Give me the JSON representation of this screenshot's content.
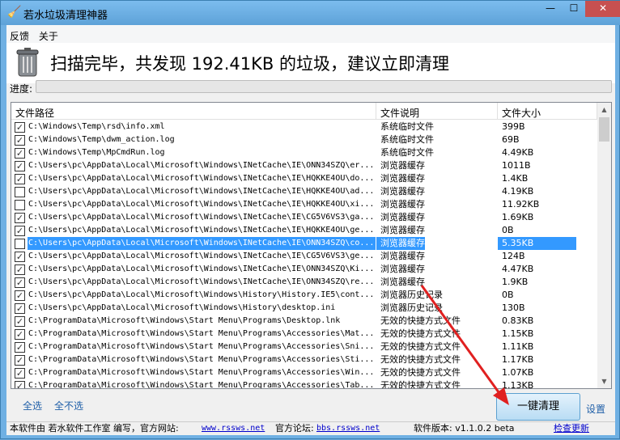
{
  "window": {
    "title": "若水垃圾清理神器",
    "minimize": "—",
    "maximize": "☐",
    "close": "✕"
  },
  "menu": [
    "反馈",
    "关于"
  ],
  "banner": {
    "headline": "扫描完毕，共发现 192.41KB 的垃圾，建议立即清理"
  },
  "progress": {
    "label": "进度:",
    "value": 0
  },
  "table": {
    "headers": [
      "文件路径",
      "文件说明",
      "文件大小"
    ],
    "rows": [
      {
        "checked": true,
        "path": "C:\\Windows\\Temp\\rsd\\info.xml",
        "desc": "系统临时文件",
        "size": "399B"
      },
      {
        "checked": true,
        "path": "C:\\Windows\\Temp\\dwm_action.log",
        "desc": "系统临时文件",
        "size": "69B"
      },
      {
        "checked": true,
        "path": "C:\\Windows\\Temp\\MpCmdRun.log",
        "desc": "系统临时文件",
        "size": "4.49KB"
      },
      {
        "checked": true,
        "path": "C:\\Users\\pc\\AppData\\Local\\Microsoft\\Windows\\INetCache\\IE\\ONN34SZQ\\er...",
        "desc": "浏览器缓存",
        "size": "1011B"
      },
      {
        "checked": true,
        "path": "C:\\Users\\pc\\AppData\\Local\\Microsoft\\Windows\\INetCache\\IE\\HQKKE4OU\\do...",
        "desc": "浏览器缓存",
        "size": "1.4KB"
      },
      {
        "checked": false,
        "path": "C:\\Users\\pc\\AppData\\Local\\Microsoft\\Windows\\INetCache\\IE\\HQKKE4OU\\ad...",
        "desc": "浏览器缓存",
        "size": "4.19KB"
      },
      {
        "checked": false,
        "path": "C:\\Users\\pc\\AppData\\Local\\Microsoft\\Windows\\INetCache\\IE\\HQKKE4OU\\xi...",
        "desc": "浏览器缓存",
        "size": "11.92KB"
      },
      {
        "checked": true,
        "path": "C:\\Users\\pc\\AppData\\Local\\Microsoft\\Windows\\INetCache\\IE\\CG5V6VS3\\ga...",
        "desc": "浏览器缓存",
        "size": "1.69KB"
      },
      {
        "checked": true,
        "path": "C:\\Users\\pc\\AppData\\Local\\Microsoft\\Windows\\INetCache\\IE\\HQKKE4OU\\ge...",
        "desc": "浏览器缓存",
        "size": "0B"
      },
      {
        "checked": false,
        "selected": true,
        "path": "C:\\Users\\pc\\AppData\\Local\\Microsoft\\Windows\\INetCache\\IE\\ONN34SZQ\\co...",
        "desc": "浏览器缓存",
        "size": "5.35KB"
      },
      {
        "checked": true,
        "path": "C:\\Users\\pc\\AppData\\Local\\Microsoft\\Windows\\INetCache\\IE\\CG5V6VS3\\ge...",
        "desc": "浏览器缓存",
        "size": "124B"
      },
      {
        "checked": true,
        "path": "C:\\Users\\pc\\AppData\\Local\\Microsoft\\Windows\\INetCache\\IE\\ONN34SZQ\\Ki...",
        "desc": "浏览器缓存",
        "size": "4.47KB"
      },
      {
        "checked": true,
        "path": "C:\\Users\\pc\\AppData\\Local\\Microsoft\\Windows\\INetCache\\IE\\ONN34SZQ\\re...",
        "desc": "浏览器缓存",
        "size": "1.9KB"
      },
      {
        "checked": true,
        "path": "C:\\Users\\pc\\AppData\\Local\\Microsoft\\Windows\\History\\History.IE5\\cont...",
        "desc": "浏览器历史记录",
        "size": "0B"
      },
      {
        "checked": true,
        "path": "C:\\Users\\pc\\AppData\\Local\\Microsoft\\Windows\\History\\desktop.ini",
        "desc": "浏览器历史记录",
        "size": "130B"
      },
      {
        "checked": true,
        "path": "C:\\ProgramData\\Microsoft\\Windows\\Start Menu\\Programs\\Desktop.lnk",
        "desc": "无效的快捷方式文件",
        "size": "0.83KB"
      },
      {
        "checked": true,
        "path": "C:\\ProgramData\\Microsoft\\Windows\\Start Menu\\Programs\\Accessories\\Mat...",
        "desc": "无效的快捷方式文件",
        "size": "1.15KB"
      },
      {
        "checked": true,
        "path": "C:\\ProgramData\\Microsoft\\Windows\\Start Menu\\Programs\\Accessories\\Sni...",
        "desc": "无效的快捷方式文件",
        "size": "1.11KB"
      },
      {
        "checked": true,
        "path": "C:\\ProgramData\\Microsoft\\Windows\\Start Menu\\Programs\\Accessories\\Sti...",
        "desc": "无效的快捷方式文件",
        "size": "1.17KB"
      },
      {
        "checked": true,
        "path": "C:\\ProgramData\\Microsoft\\Windows\\Start Menu\\Programs\\Accessories\\Win...",
        "desc": "无效的快捷方式文件",
        "size": "1.07KB"
      },
      {
        "checked": true,
        "path": "C:\\ProgramData\\Microsoft\\Windows\\Start Menu\\Programs\\Accessories\\Tab...",
        "desc": "无效的快捷方式文件",
        "size": "1.13KB"
      }
    ]
  },
  "actions": {
    "select_all": "全选",
    "select_none": "全不选",
    "clean": "一键清理",
    "settings": "设置"
  },
  "status": {
    "made_by": "本软件由 若水软件工作室 编写，官方网站:",
    "site": "www.rssws.net",
    "forum_label": "官方论坛:",
    "forum": "bbs.rssws.net",
    "version": "软件版本: v1.1.0.2 beta",
    "check_update": "检查更新"
  }
}
